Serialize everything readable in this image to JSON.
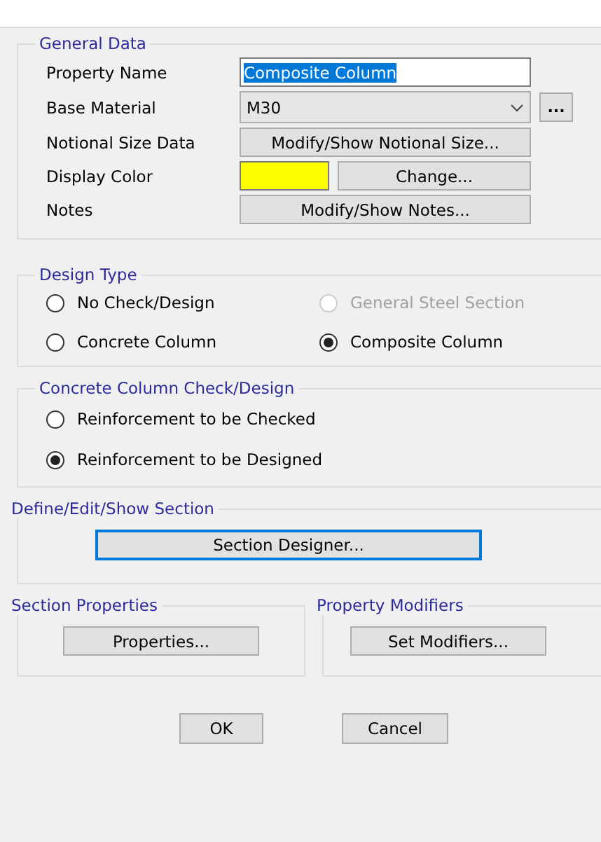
{
  "general_data": {
    "title": "General Data",
    "fields": [
      {
        "kind": "text",
        "label": "Property Name",
        "value": "Composite Column",
        "highlighted": true
      },
      {
        "kind": "select",
        "label": "Base Material",
        "value": "M30",
        "button": "..."
      },
      {
        "kind": "button",
        "label": "Notional Size Data",
        "button": "Modify/Show Notional Size..."
      },
      {
        "kind": "color",
        "label": "Display Color",
        "color": "#ffff00",
        "button": "Change..."
      },
      {
        "kind": "button",
        "label": "Notes",
        "button": "Modify/Show Notes..."
      }
    ]
  },
  "design_type": {
    "title": "Design Type",
    "options": [
      {
        "label": "No Check/Design",
        "selected": false,
        "disabled": false
      },
      {
        "label": "General Steel Section",
        "selected": false,
        "disabled": true
      },
      {
        "label": "Concrete Column",
        "selected": false,
        "disabled": false
      },
      {
        "label": "Composite Column",
        "selected": true,
        "disabled": false
      }
    ]
  },
  "concrete_check": {
    "title": "Concrete Column Check/Design",
    "options": [
      {
        "label": "Reinforcement to be Checked",
        "selected": false
      },
      {
        "label": "Reinforcement to be Designed",
        "selected": true
      }
    ]
  },
  "section": {
    "title": "Define/Edit/Show Section",
    "button": "Section Designer..."
  },
  "section_properties": {
    "title": "Section Properties",
    "button": "Properties..."
  },
  "property_modifiers": {
    "title": "Property Modifiers",
    "button": "Set Modifiers..."
  },
  "buttons": [
    "OK",
    "Cancel"
  ]
}
